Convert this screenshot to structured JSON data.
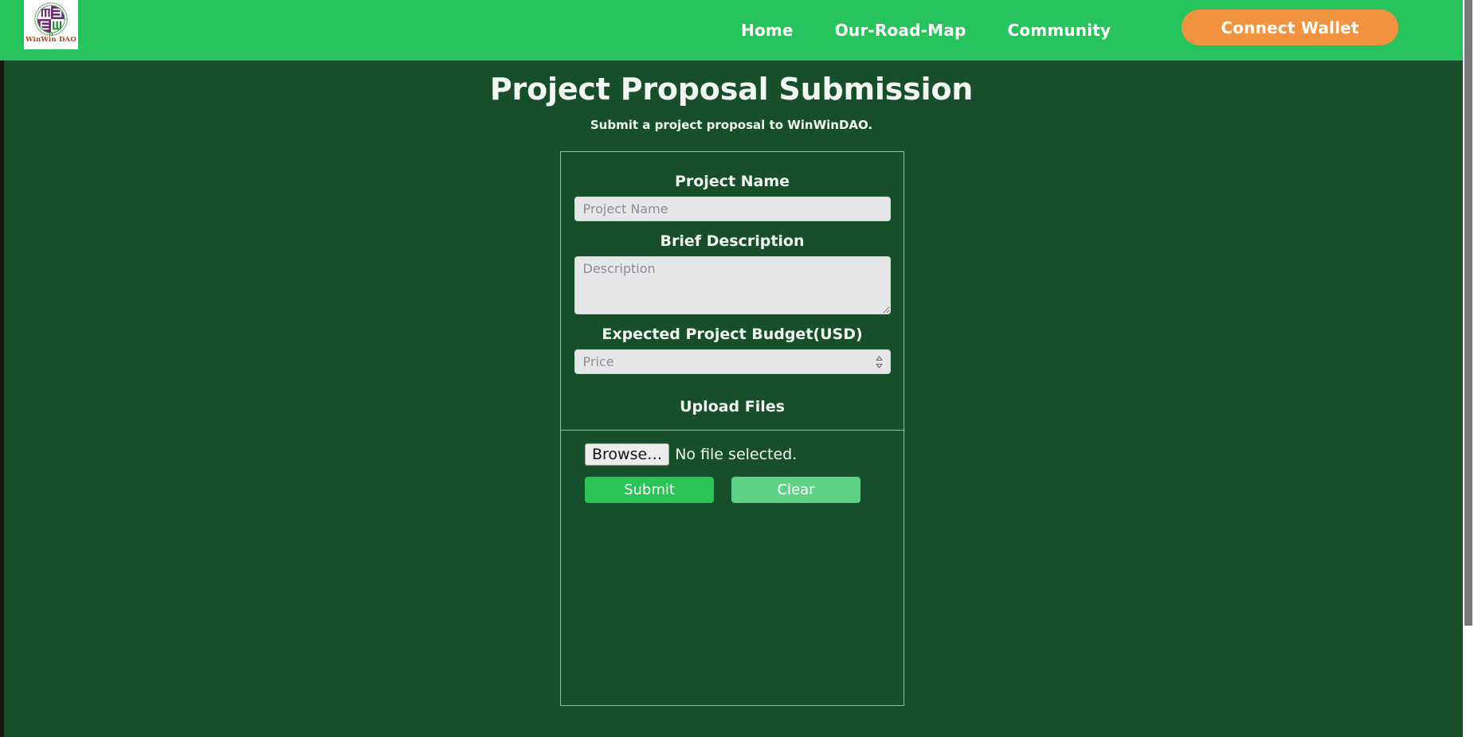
{
  "theme": {
    "header_green": "#27c45e",
    "body_green": "#174f2b",
    "accent_orange": "#f2943f",
    "submit_green": "#2ac355",
    "clear_green": "#5fd289",
    "card_border": "#8fbf9e",
    "input_bg": "#e6e7e9"
  },
  "header": {
    "logo": {
      "name": "winwin-dao-logo",
      "caption": "WinWin DAO"
    },
    "nav_items": [
      {
        "label": "Home"
      },
      {
        "label": "Our-Road-Map"
      },
      {
        "label": "Community"
      }
    ],
    "wallet_button": "Connect Wallet"
  },
  "hero": {
    "title": "Project Proposal Submission",
    "subtitle": "Submit a project proposal to WinWinDAO."
  },
  "form": {
    "fields": [
      {
        "label": "Project Name",
        "placeholder": "Project Name",
        "value": "",
        "type": "text"
      },
      {
        "label": "Brief Description",
        "placeholder": "Description",
        "value": "",
        "type": "textarea"
      },
      {
        "label": "Expected Project Budget(USD)",
        "placeholder": "Price",
        "value": "",
        "type": "number"
      }
    ],
    "upload": {
      "heading": "Upload Files",
      "browse_label": "Browse…",
      "status": "No file selected."
    },
    "actions": {
      "submit_label": "Submit",
      "clear_label": "Clear"
    }
  }
}
